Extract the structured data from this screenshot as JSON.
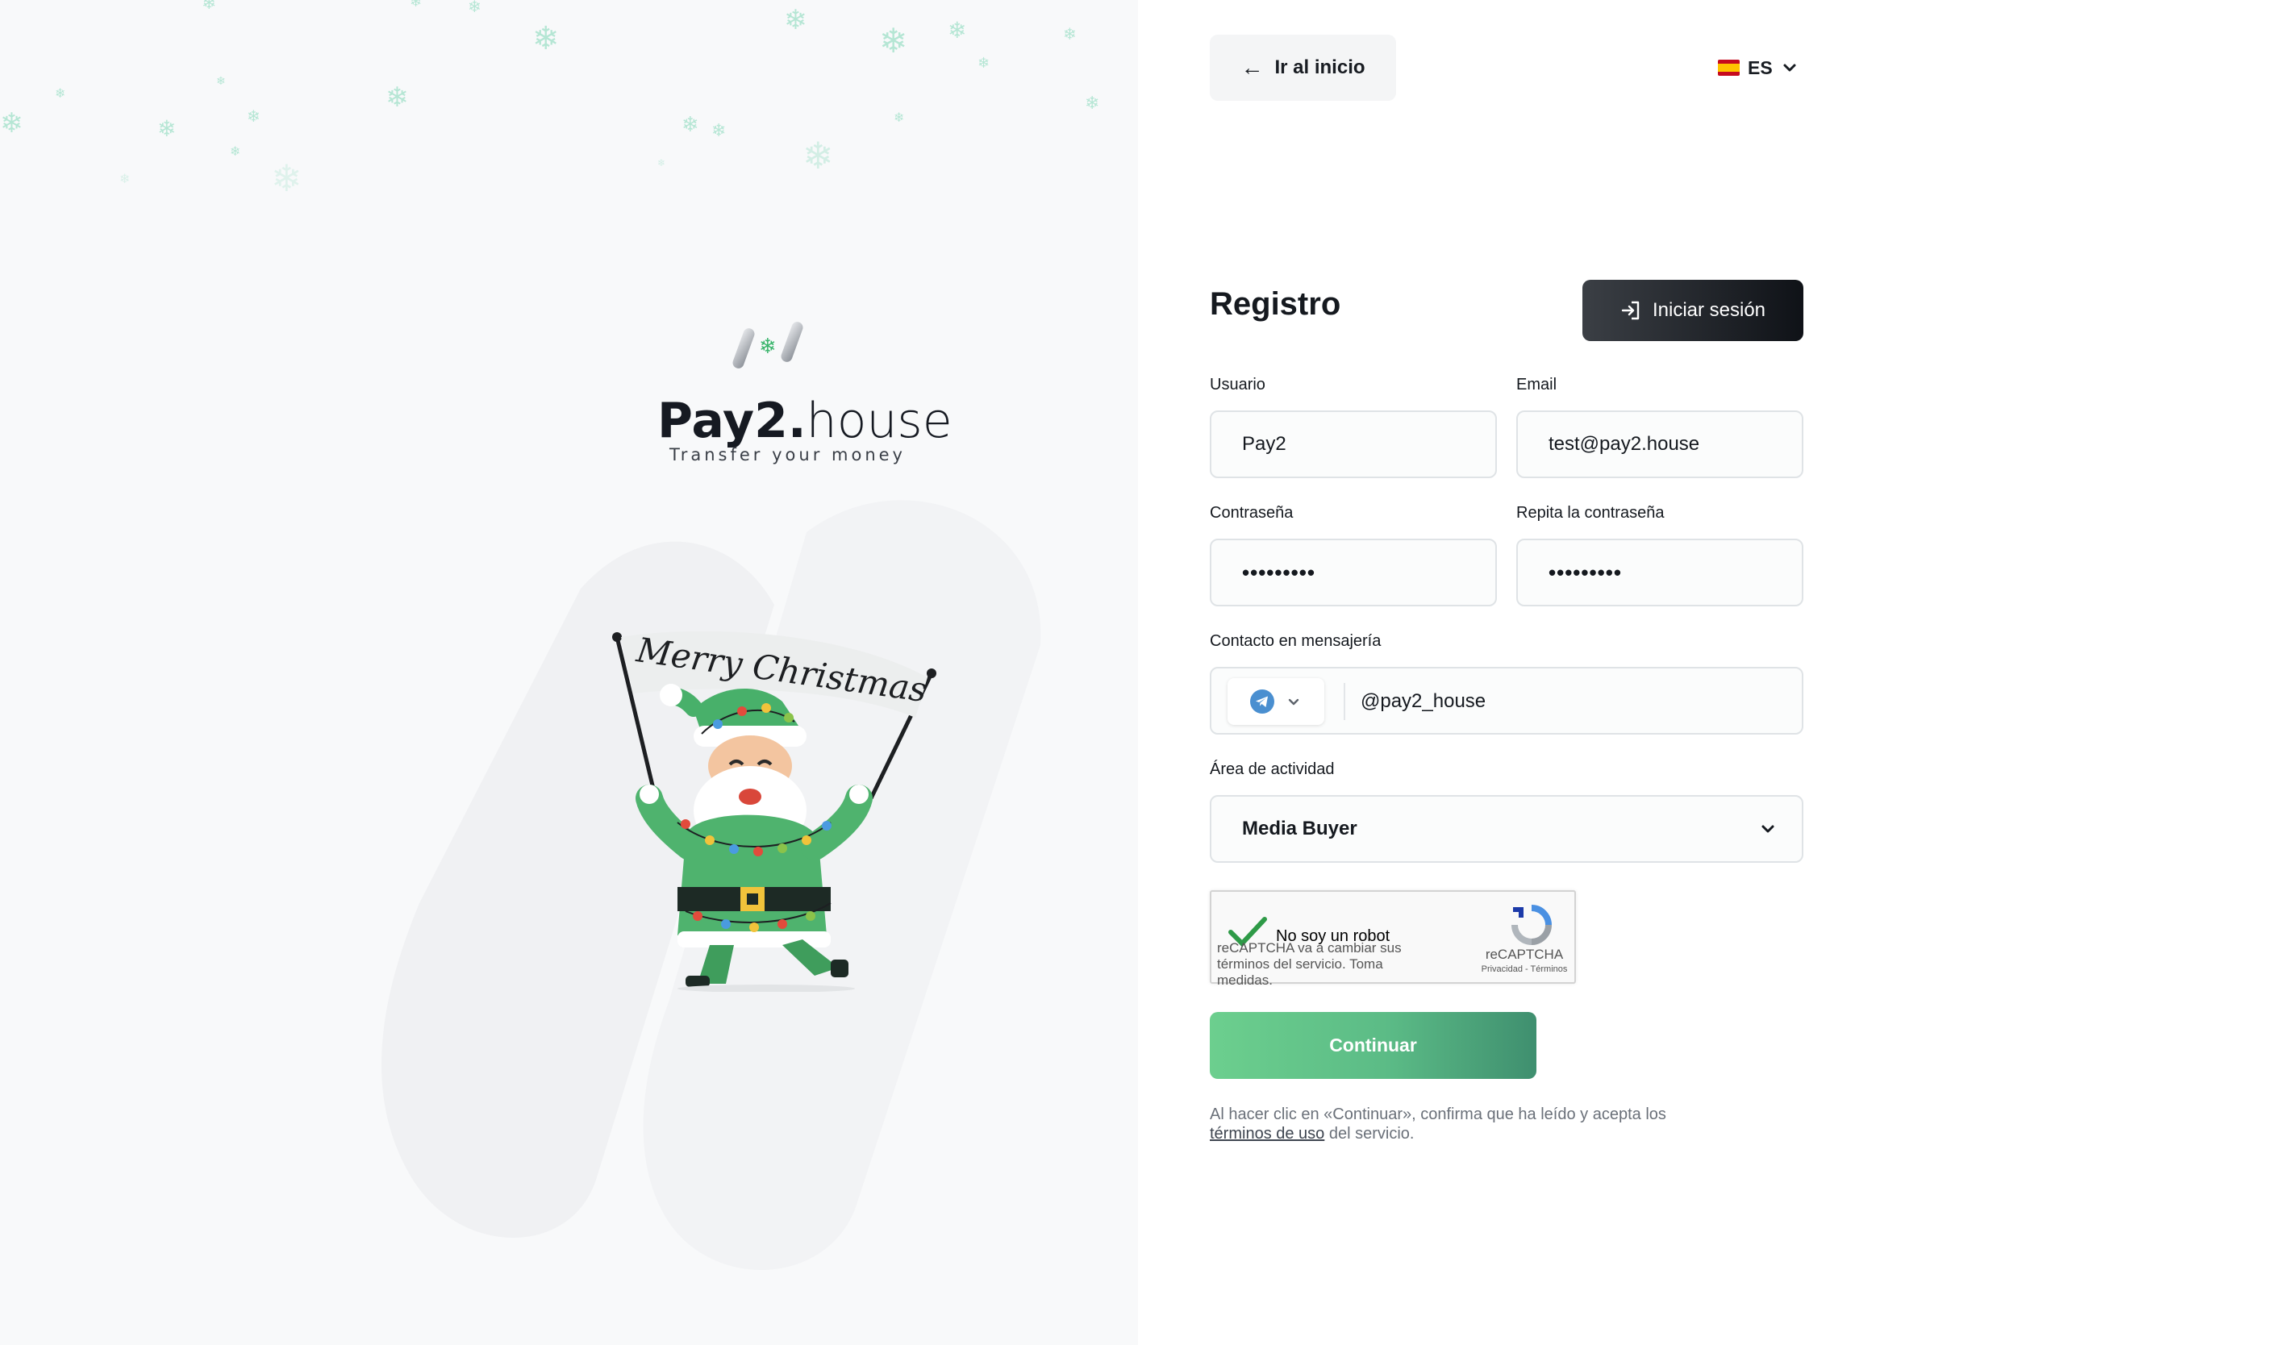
{
  "brand": {
    "name_bold": "Pay2.",
    "name_light": "house",
    "tagline": "Transfer your money",
    "banner_text": "Merry Christmas"
  },
  "nav": {
    "home_label": "Ir al inicio",
    "language": "ES"
  },
  "form": {
    "title": "Registro",
    "login_label": "Iniciar sesión",
    "username": {
      "label": "Usuario",
      "value": "Pay2"
    },
    "email": {
      "label": "Email",
      "value": "test@pay2.house"
    },
    "password": {
      "label": "Contraseña",
      "value": "•••••••••"
    },
    "password_repeat": {
      "label": "Repita la contraseña",
      "value": "•••••••••"
    },
    "messenger": {
      "label": "Contacto en mensajería",
      "type_icon": "telegram-icon",
      "value": "@pay2_house"
    },
    "activity": {
      "label": "Área de actividad",
      "value": "Media Buyer"
    },
    "captcha": {
      "label": "No soy un robot",
      "warning": "reCAPTCHA va a cambiar sus términos del servicio. Toma medidas.",
      "brand": "reCAPTCHA",
      "links": "Privacidad - Términos"
    },
    "continue_label": "Continuar",
    "terms": {
      "prefix": "Al hacer clic en «Continuar», confirma que ha leído y acepta los",
      "link": "términos de uso",
      "suffix": "del servicio."
    }
  },
  "colors": {
    "accent_green": "#5bbb86",
    "dark_button": "#15191f",
    "snow": "#7fd7b6"
  }
}
